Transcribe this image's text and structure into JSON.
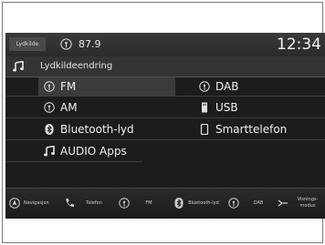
{
  "topbar": {
    "source_chip": "Lydkilde",
    "frequency": "87.9",
    "clock": "12:34"
  },
  "header": {
    "title": "Lydkildeendring"
  },
  "menu": {
    "left": [
      {
        "label": "FM",
        "icon": "radio-icon"
      },
      {
        "label": "AM",
        "icon": "radio-icon"
      },
      {
        "label": "Bluetooth-lyd",
        "icon": "bluetooth-icon"
      },
      {
        "label": "AUDIO Apps",
        "icon": "music-note-icon"
      }
    ],
    "right": [
      {
        "label": "DAB",
        "icon": "radio-icon"
      },
      {
        "label": "USB",
        "icon": "usb-icon"
      },
      {
        "label": "Smarttelefon",
        "icon": "smartphone-icon"
      }
    ]
  },
  "bottombar": {
    "navigation": "Navigasjon",
    "phone": "Telefon",
    "fm": "FM",
    "bluetooth": "Bluetooth-lyd",
    "dab": "DAB",
    "display_mode": "Visnings-modus"
  },
  "colors": {
    "screen_background": "#1c1c1c",
    "text": "#f0f0f0",
    "selected_row": "#3c3c3c"
  }
}
